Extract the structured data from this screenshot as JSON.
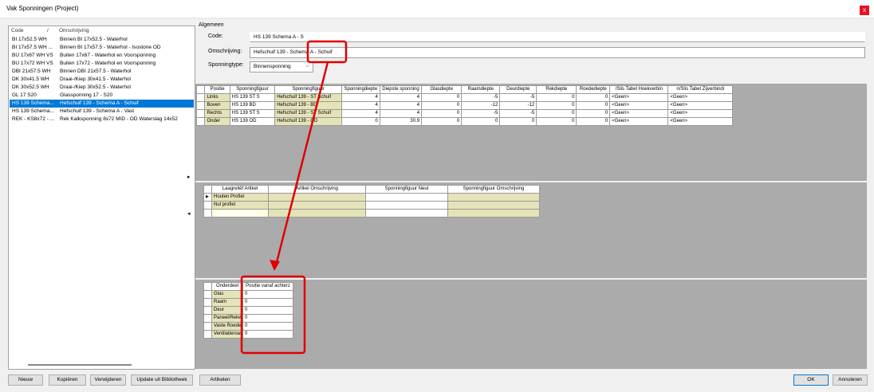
{
  "window": {
    "title": "Vak Sponningen (Project)",
    "close": "x"
  },
  "list": {
    "headers": {
      "code": "Code",
      "sep": "/",
      "desc": "Omschrijving"
    },
    "rows": [
      {
        "code": "BI 17x52.5 WH",
        "desc": "Binnen BI 17x52.5 - Waterhol"
      },
      {
        "code": "BI 17x57.5 WH ...",
        "desc": "Binnen BI 17x57.5 - Waterhol - Isostone OD"
      },
      {
        "code": "BU 17x67 WH VS",
        "desc": "Buiten 17x67 - Waterhol en Voorsponning"
      },
      {
        "code": "BU 17x72 WH VS",
        "desc": "Buiten 17x72 - Waterhol en Voorsponning"
      },
      {
        "code": "DBI 21x57.5 WH",
        "desc": "Binnen DBI 21x57.5 - Waterhol"
      },
      {
        "code": "DK 30x41.5 WH",
        "desc": "Draai-/Kiep 30x41.5 - Waterhol"
      },
      {
        "code": "DK 30x52.5 WH",
        "desc": "Draai-/Kiep 30x52.5 - Waterhol"
      },
      {
        "code": "GL 17 S20",
        "desc": "Glassponning 17 - S20"
      },
      {
        "code": "HS 139 Schema...",
        "desc": "Hefschuif 139 - Schema A - Schuif"
      },
      {
        "code": "HS 139 Schema...",
        "desc": "Hefschuif 139 - Schema A - Vast"
      },
      {
        "code": "REK - KS8x72 - ...",
        "desc": "Rek Kalksponning 8x72 MID - OD Waterslag 14x52"
      }
    ]
  },
  "algemeen": {
    "legend": "Algemeen",
    "code_label": "Code:",
    "code_value": "HS 139 Schema A - S",
    "omschrijving_label": "Omschrijving:",
    "omschrijving_value": "Hefschuif 139 - Schema A - Schuif",
    "type_label": "Sponningtype:",
    "type_value": "Binnensponning",
    "type_arrow": "⌵"
  },
  "grid1": {
    "headers": [
      "Positie",
      "Sponningfiguur",
      "Sponningfiguur",
      "Sponningdiepte",
      "Diepste sponning",
      "Glasdiepte",
      "Raamdiepte",
      "Deurdiepte",
      "Rekdiepte",
      "Roedediepte",
      "/Slis Tabel Hoekverbin",
      "n/Slis Tabel Zijverbindi"
    ],
    "rows": [
      [
        "Links",
        "HS 139 ST S",
        "Hefschuif 139 - ST Schuif",
        "4",
        "4",
        "0",
        "-5",
        "-5",
        "0",
        "0",
        "<Geen>",
        "<Geen>"
      ],
      [
        "Boven",
        "HS 139 BD",
        "Hefschuif 139 - BD",
        "4",
        "4",
        "0",
        "-12",
        "-12",
        "0",
        "0",
        "<Geen>",
        "<Geen>"
      ],
      [
        "Rechts",
        "HS 139 ST S",
        "Hefschuif 139 - ST Schuif",
        "4",
        "4",
        "0",
        "-5",
        "-5",
        "0",
        "0",
        "<Geen>",
        "<Geen>"
      ],
      [
        "Onder",
        "HS 139 OD",
        "Hefschuif 139 - OD",
        "0",
        "30.9",
        "0",
        "0",
        "0",
        "0",
        "0",
        "<Geen>",
        "<Geen>"
      ]
    ]
  },
  "grid2": {
    "headers": [
      "Laagreliëf Artikel",
      "Artikel Omschrijving",
      "Sponningfiguur Neut",
      "Sponningfiguur Omschrijving"
    ],
    "row_marker": "▶",
    "rows": [
      [
        "Houten Profiel",
        "",
        "",
        ""
      ],
      [
        "Nul profiel",
        "",
        "",
        ""
      ],
      [
        "",
        "",
        "",
        ""
      ]
    ]
  },
  "grid3": {
    "headers": [
      "Onderdeel",
      "Positie vanaf achterz"
    ],
    "rows": [
      [
        "Glas",
        "0"
      ],
      [
        "Raam",
        "0"
      ],
      [
        "Deur",
        "0"
      ],
      [
        "Paneel/Rekwerk",
        "0"
      ],
      [
        "Vaste Roedes",
        "0"
      ],
      [
        "Ventilatieroaste",
        "0"
      ]
    ]
  },
  "splitter": {
    "right_arrow": "▸",
    "left_arrow": "◂"
  },
  "buttons": {
    "nieuw": "Nieuw",
    "kopieren": "Kopiëren",
    "verwijderen": "Verwijderen",
    "update": "Update uit Bibliotheek",
    "artikelen": "Artikelen",
    "ok": "OK",
    "annuleren": "Annuleren"
  },
  "colors": {
    "selection": "#0078d7",
    "yellow_cell": "#e5e3b8",
    "annotation": "#e00000"
  }
}
